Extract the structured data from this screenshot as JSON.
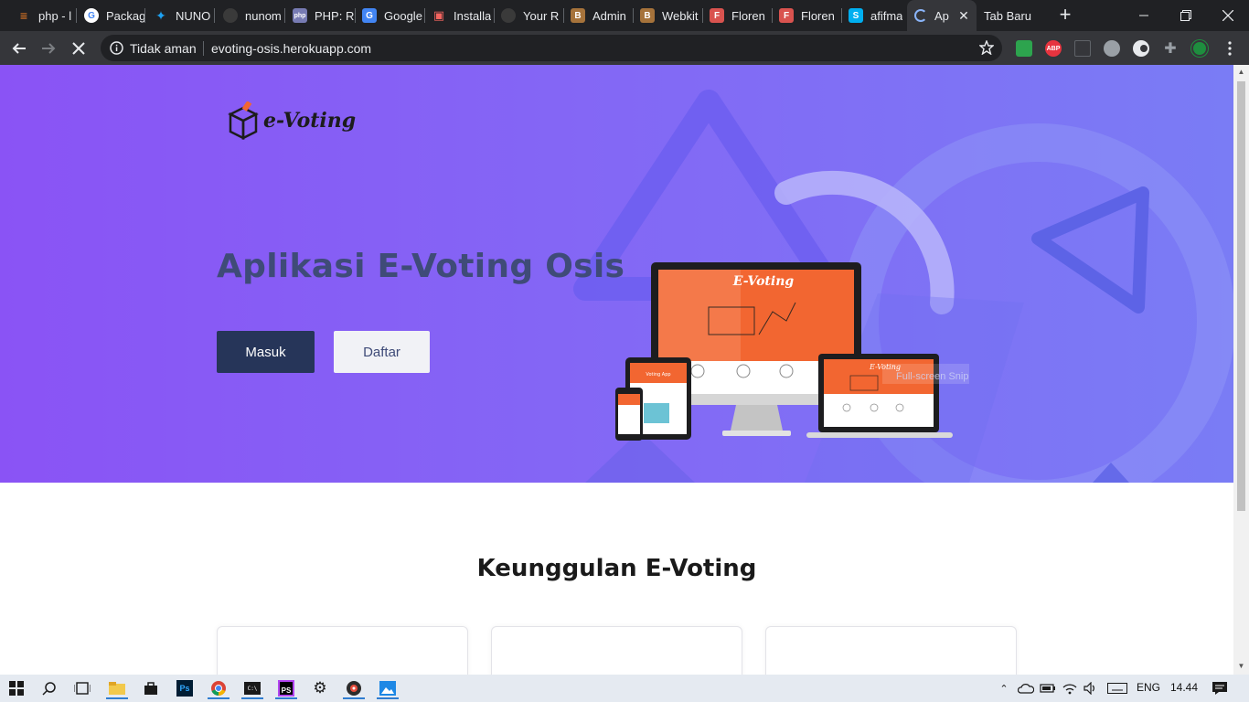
{
  "browser": {
    "tabs": [
      {
        "title": "php - l",
        "icon": "stackoverflow-icon",
        "color": "#f48024"
      },
      {
        "title": "Packag",
        "icon": "google-icon",
        "color": "#4285f4"
      },
      {
        "title": "NUNO",
        "icon": "twitter-icon",
        "color": "#1da1f2"
      },
      {
        "title": "nunom",
        "icon": "github-icon",
        "color": "#3a3a3a"
      },
      {
        "title": "PHP: R",
        "icon": "php-icon",
        "color": "#777bb3"
      },
      {
        "title": "Google",
        "icon": "google-translate-icon",
        "color": "#4285f4"
      },
      {
        "title": "Installa",
        "icon": "laravel-icon",
        "color": "#f4645f"
      },
      {
        "title": "Your R",
        "icon": "github-icon",
        "color": "#3a3a3a"
      },
      {
        "title": "Admin",
        "icon": "bootstrap-icon",
        "color": "#a6733b"
      },
      {
        "title": "Webkit",
        "icon": "bootstrap-icon",
        "color": "#a6733b"
      },
      {
        "title": "Floren",
        "icon": "florence-icon",
        "color": "#d9534f"
      },
      {
        "title": "Floren",
        "icon": "florence-icon",
        "color": "#d9534f"
      },
      {
        "title": "afifma",
        "icon": "skype-icon",
        "color": "#00aff0"
      },
      {
        "title": "Ap",
        "icon": "loading-icon",
        "color": "#e8eaed"
      },
      {
        "title": "Tab Baru",
        "icon": "",
        "color": ""
      }
    ],
    "new_tab_symbol": "+",
    "omnibox": {
      "security_status": "Tidak aman",
      "url": "evoting-osis.herokuapp.com"
    },
    "extensions": [
      {
        "label": "",
        "icon": "extension-drive-icon",
        "color": "#2da44e"
      },
      {
        "label": "ABP",
        "icon": "adblock-plus-icon",
        "color": "#e7343f"
      },
      {
        "label": "",
        "icon": "extension-screen-icon",
        "color": "#5f6368"
      },
      {
        "label": "",
        "icon": "extension-globe-icon",
        "color": "#9aa0a6"
      },
      {
        "label": "",
        "icon": "extension-dark-icon",
        "color": "#e8eaed"
      },
      {
        "label": "",
        "icon": "extensions-puzzle-icon",
        "color": "#9aa0a6"
      },
      {
        "label": "",
        "icon": "profile-avatar-icon",
        "color": "#1e8e3e"
      }
    ]
  },
  "page": {
    "logo_text": "e-Voting",
    "hero_title": "Aplikasi E-Voting Osis",
    "login_button": "Masuk",
    "register_button": "Daftar",
    "device_screen_title": "E-Voting",
    "device_tablet_title": "Voting App",
    "snip_overlay_text": "Full-screen Snip",
    "section_title": "Keunggulan E-Voting",
    "feature_cards_count": 3
  },
  "taskbar": {
    "language": "ENG",
    "time": "14.44"
  },
  "colors": {
    "hero_start": "#8a53f5",
    "hero_end": "#7a7cf5",
    "hero_title": "#3f4b78",
    "login_button": "#263559",
    "register_button": "#f1f2f6",
    "device_accent": "#f26631"
  }
}
